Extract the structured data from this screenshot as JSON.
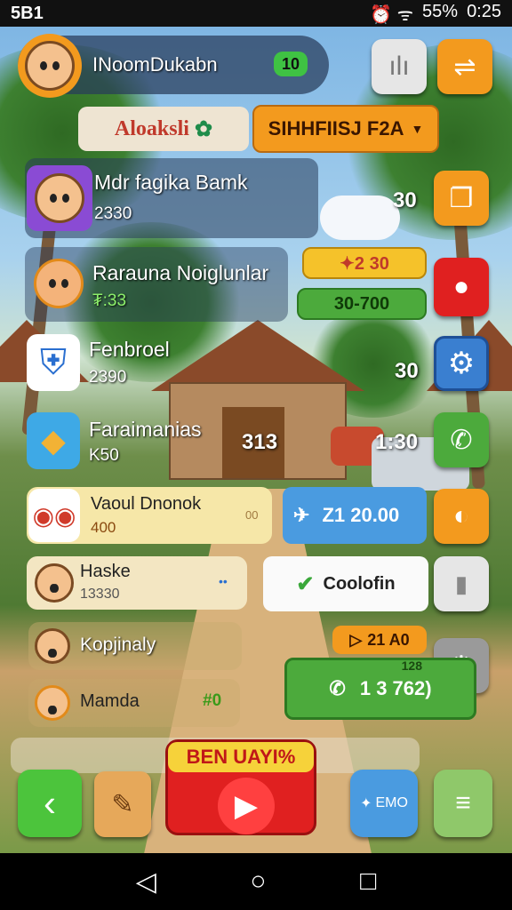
{
  "status": {
    "left": "5B1",
    "right_icons": "⏰ ᯤ",
    "battery": "55%",
    "time": "0:25"
  },
  "header": {
    "player_name": "INoomDukabn",
    "level_badge": "10",
    "top_btn1": "ılı"
  },
  "tabs": {
    "left": "Aloaksli",
    "right": "SIHHFIISJ F2A"
  },
  "rows": [
    {
      "name": "Mdr fagika Bamk",
      "value": "2330",
      "side_value": "30"
    },
    {
      "name": "Rarauna Noiglunlar",
      "value": "₮:33",
      "badge": "✦2 30",
      "bar": "30-700"
    },
    {
      "name": "Fenbroel",
      "value": "2390",
      "side_value": "30"
    },
    {
      "name": "Faraimanias",
      "value": "K50",
      "mid_value": "313",
      "side_value": "1:30"
    },
    {
      "name": "Vaoul Dnonok",
      "value": "400",
      "mini": "00",
      "action": "Z1 20.00"
    },
    {
      "name": "Haske",
      "value": "13330",
      "dots": "••",
      "action": "Coolofin"
    },
    {
      "name": "Kopjinaly",
      "reward": "21 A0"
    },
    {
      "name": "Mamda",
      "value": "#0",
      "call": "1  3 762)",
      "call_small": "128"
    }
  ],
  "bottom": {
    "banner": "BEN UAYI%"
  },
  "bottom_btn": "EMO",
  "colors": {
    "orange": "#f39a1e",
    "red": "#e02020",
    "green": "#4caa3c",
    "blue": "#3a7fd0"
  }
}
